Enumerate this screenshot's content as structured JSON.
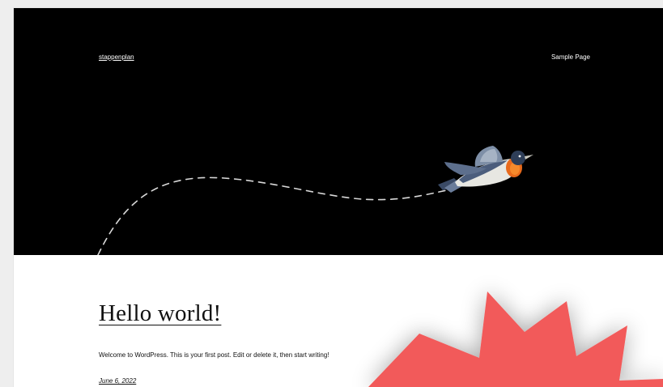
{
  "header": {
    "site_title": "stappenplan",
    "nav": [
      {
        "label": "Sample Page"
      }
    ]
  },
  "post": {
    "title": "Hello world!",
    "excerpt": "Welcome to WordPress. This is your first post. Edit or delete it, then start writing!",
    "date": "June 6, 2022"
  },
  "colors": {
    "hero_background": "#000000",
    "page_background": "#ffffff",
    "outer_background": "#eeeeee",
    "starburst": "#f25a5a",
    "text": "#111111"
  },
  "icons": {
    "hero_illustration": "bird-icon",
    "overlay_shape": "starburst-icon"
  }
}
